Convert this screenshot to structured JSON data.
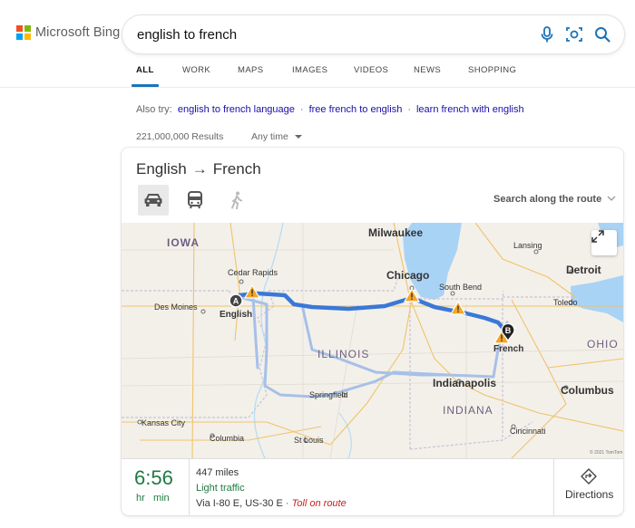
{
  "brand": {
    "name": "Microsoft Bing"
  },
  "search": {
    "query": "english to french"
  },
  "tabs": [
    {
      "label": "ALL",
      "active": true
    },
    {
      "label": "WORK"
    },
    {
      "label": "MAPS"
    },
    {
      "label": "IMAGES"
    },
    {
      "label": "VIDEOS"
    },
    {
      "label": "NEWS"
    },
    {
      "label": "SHOPPING"
    }
  ],
  "also_try": {
    "prefix": "Also try:",
    "links": [
      "english to french language",
      "free french to english",
      "learn french with english"
    ]
  },
  "results_count": "221,000,000 Results",
  "time_filter": "Any time",
  "route": {
    "from": "English",
    "arrow": "→",
    "to": "French",
    "search_along": "Search along the route",
    "time": "6:56",
    "time_units": {
      "hr": "hr",
      "min": "min"
    },
    "distance": "447 miles",
    "traffic": "Light traffic",
    "via": "Via I-80 E, US-30 E",
    "separator": "·",
    "toll": "Toll on route",
    "directions_label": "Directions"
  },
  "map": {
    "labels": {
      "iowa": "IOWA",
      "milwaukee": "Milwaukee",
      "lansing": "Lansing",
      "detroit": "Detroit",
      "cedar_rapids": "Cedar Rapids",
      "chicago": "Chicago",
      "south_bend": "South Bend",
      "toledo": "Toledo",
      "des_moines": "Des Moines",
      "english": "English",
      "illinois": "ILLINOIS",
      "french": "French",
      "ohio": "OHIO",
      "indianapolis": "Indianapolis",
      "springfield": "Springfield",
      "columbus": "Columbus",
      "indiana": "INDIANA",
      "kansas_city": "Kansas City",
      "columbia": "Columbia",
      "st_louis": "St Louis",
      "cincinnati": "Cincinnati",
      "marker_a": "A",
      "marker_b": "B",
      "copyright": "© 2021 TomTom"
    }
  },
  "colors": {
    "route": "#3a78d8",
    "alt_route": "#a6c0e8",
    "water": "#a9d3f5",
    "traffic_green": "#1f7a43",
    "toll_red": "#c5221f",
    "link": "#1a0dab"
  },
  "icons": [
    "mic-icon",
    "visual-search-icon",
    "search-icon",
    "car-icon",
    "transit-icon",
    "walk-icon",
    "chevron-down-icon",
    "expand-icon",
    "directions-icon",
    "warning-icon"
  ]
}
